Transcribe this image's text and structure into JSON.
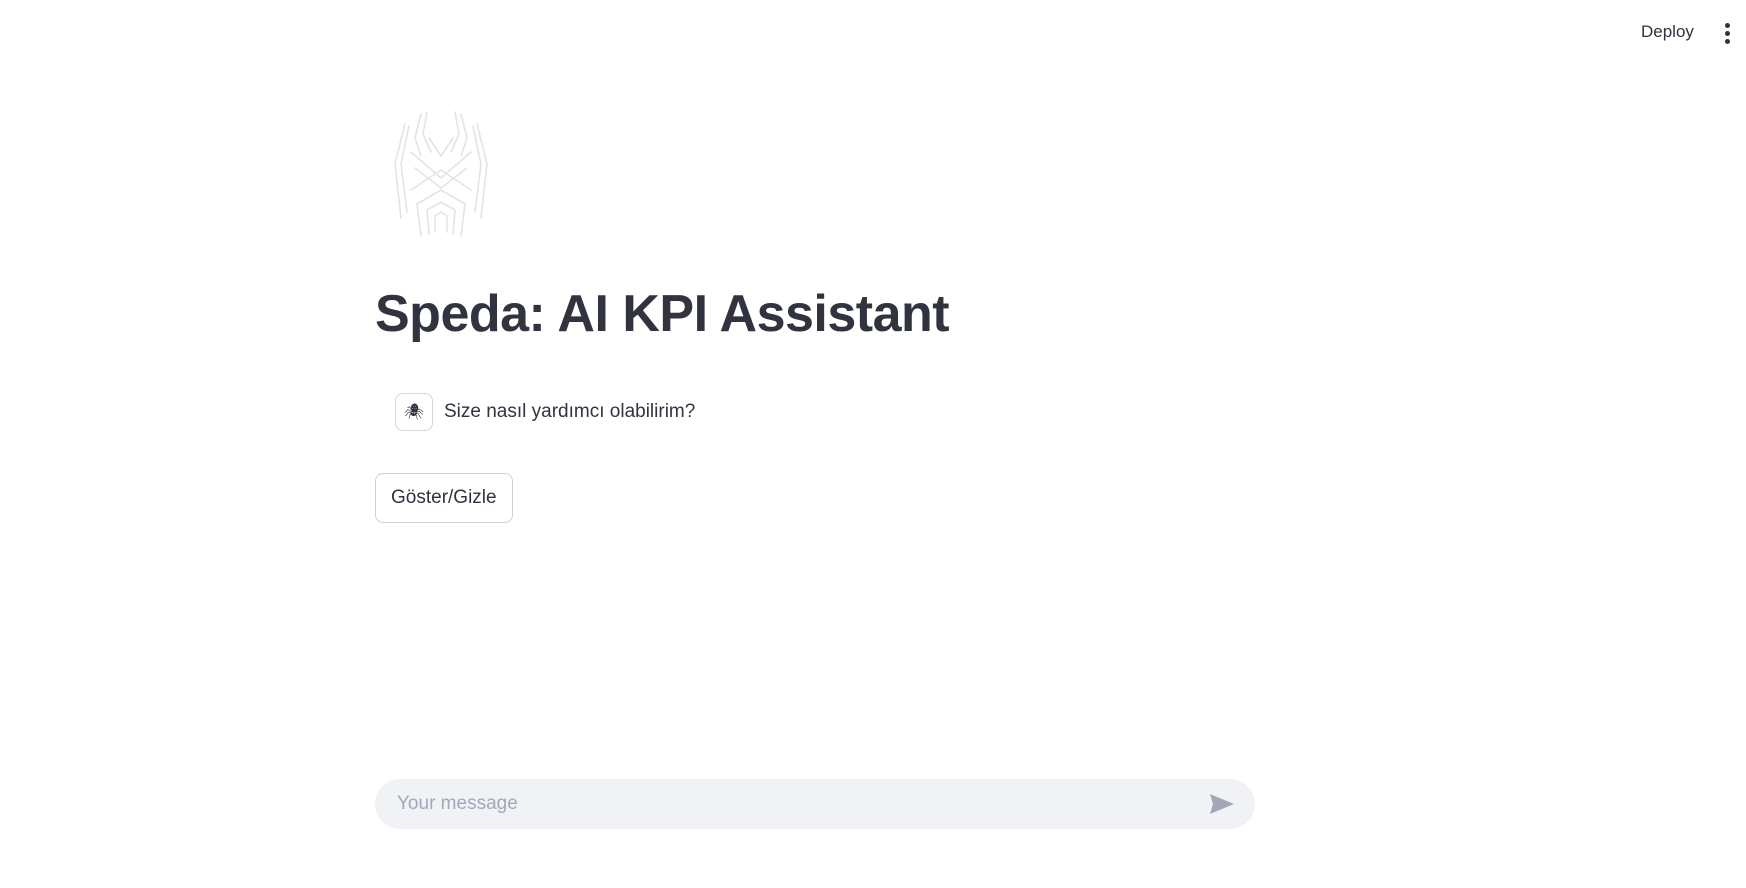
{
  "header": {
    "deploy_label": "Deploy",
    "menu_icon": "more-vertical-icon"
  },
  "main": {
    "logo_icon": "spider-logo",
    "title": "Speda: AI KPI Assistant",
    "messages": [
      {
        "role": "assistant",
        "avatar_icon": "spider-icon",
        "avatar_glyph": "🕷",
        "text": "Size nasıl yardımcı olabilirim?"
      }
    ],
    "toggle_button_label": "Göster/Gizle"
  },
  "chat_input": {
    "placeholder": "Your message",
    "value": "",
    "send_icon": "send-icon"
  },
  "colors": {
    "text": "#31333f",
    "input_bg": "#f0f2f6",
    "placeholder": "#a3a8b8",
    "border": "#d0d0d5"
  }
}
